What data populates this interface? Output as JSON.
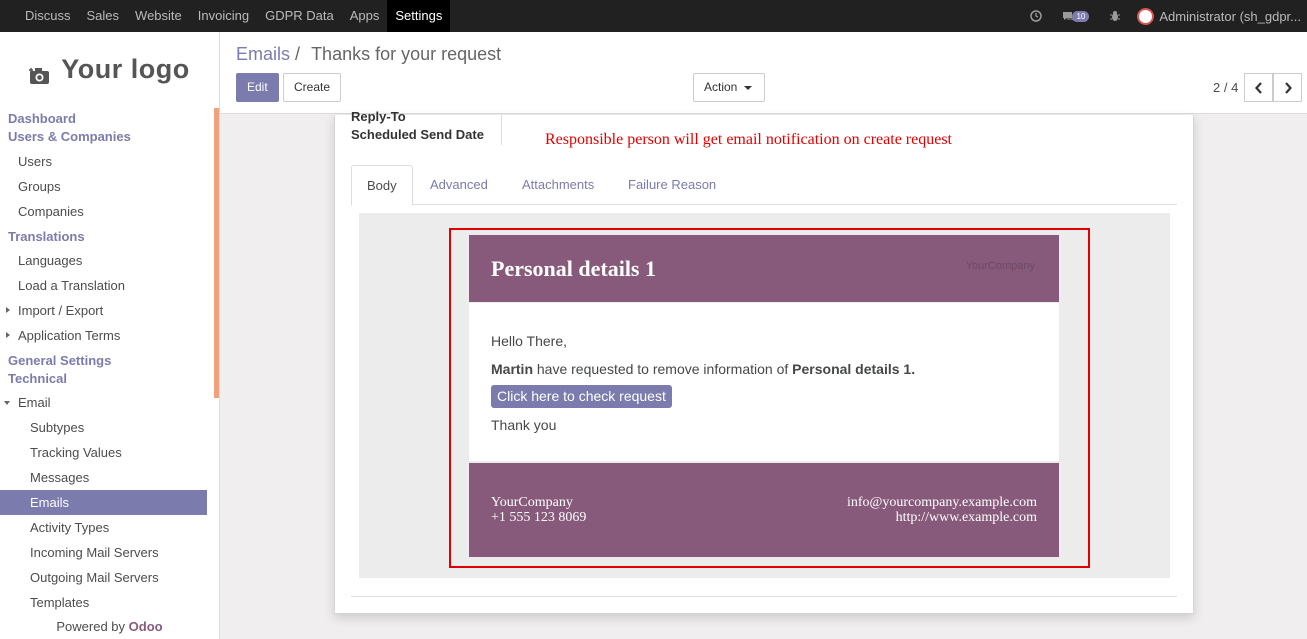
{
  "topbar": {
    "menu": [
      "Discuss",
      "Sales",
      "Website",
      "Invoicing",
      "GDPR Data",
      "Apps",
      "Settings"
    ],
    "active_menu": "Settings",
    "chat_count": "10",
    "user": "Administrator (sh_gdpr..."
  },
  "sidebar": {
    "logo_text": "Your logo",
    "sections": {
      "dashboard": "Dashboard",
      "users_companies": "Users & Companies",
      "translations": "Translations",
      "general_settings": "General Settings",
      "technical": "Technical"
    },
    "items": {
      "users": "Users",
      "groups": "Groups",
      "companies": "Companies",
      "languages": "Languages",
      "load_translation": "Load a Translation",
      "import_export": "Import / Export",
      "application_terms": "Application Terms",
      "email": "Email",
      "subtypes": "Subtypes",
      "tracking_values": "Tracking Values",
      "messages": "Messages",
      "emails": "Emails",
      "activity_types": "Activity Types",
      "incoming_mail": "Incoming Mail Servers",
      "outgoing_mail": "Outgoing Mail Servers",
      "templates": "Templates"
    },
    "powered_by": "Powered by",
    "powered_brand": "Odoo"
  },
  "control": {
    "breadcrumb_parent": "Emails",
    "breadcrumb_sep": "/",
    "breadcrumb_current": "Thanks for your request",
    "edit_label": "Edit",
    "create_label": "Create",
    "action_label": "Action",
    "pager": "2 / 4"
  },
  "form": {
    "reply_to_label": "Reply-To",
    "scheduled_label": "Scheduled Send Date",
    "annotation": "Responsible person will get email notification on create request",
    "tabs": [
      "Body",
      "Advanced",
      "Attachments",
      "Failure Reason"
    ],
    "active_tab": "Body"
  },
  "email": {
    "title": "Personal details 1",
    "logo_text": "YourCompany",
    "greeting": "Hello There,",
    "requester": "Martin",
    "request_text": " have requested to remove information of ",
    "record_name": "Personal details 1.",
    "button_label": "Click here to check request",
    "closing": "Thank you",
    "company": "YourCompany",
    "phone": "+1 555 123 8069",
    "email": "info@yourcompany.example.com",
    "website": "http://www.example.com"
  },
  "colors": {
    "brand": "#875a7b",
    "primary": "#7c7bad",
    "annotation": "#e00000"
  }
}
